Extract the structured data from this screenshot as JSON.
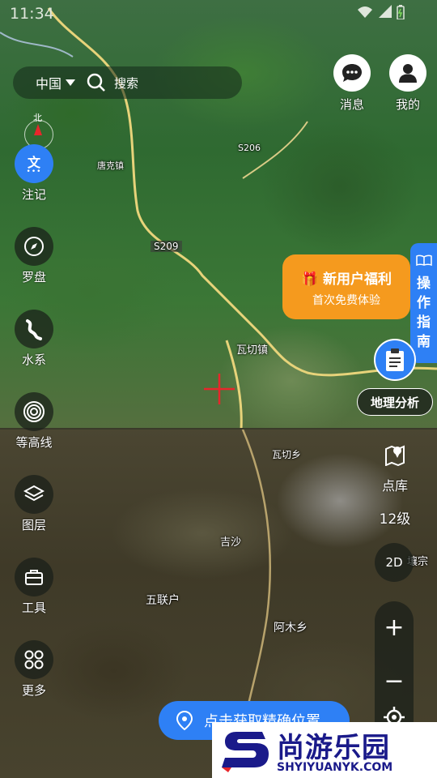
{
  "status_bar": {
    "time": "11:34"
  },
  "search": {
    "region": "中国",
    "placeholder": "搜索"
  },
  "top_actions": [
    {
      "label": "消息",
      "icon": "message-icon"
    },
    {
      "label": "我的",
      "icon": "user-icon"
    }
  ],
  "left_tools": [
    {
      "label": "注记",
      "icon": "annotation-icon",
      "active": true,
      "glyph": "文"
    },
    {
      "label": "罗盘",
      "icon": "compass-icon"
    },
    {
      "label": "水系",
      "icon": "river-icon"
    },
    {
      "label": "等高线",
      "icon": "contour-icon"
    },
    {
      "label": "图层",
      "icon": "layers-icon"
    },
    {
      "label": "工具",
      "icon": "toolbox-icon"
    },
    {
      "label": "更多",
      "icon": "more-icon"
    }
  ],
  "promo": {
    "title": "新用户福利",
    "subtitle": "首次免费体验"
  },
  "guide": {
    "label": "操作指南"
  },
  "analysis": {
    "label": "地理分析"
  },
  "right_tools": {
    "poi_label": "点库",
    "zoom_level": "12级",
    "view_mode": "2D",
    "zoom_in": "+",
    "zoom_out": "−"
  },
  "locate": {
    "label": "点击获取精确位置"
  },
  "map_labels": {
    "road_s209": "S209",
    "road_s206": "S206",
    "town_top": "瓦切镇",
    "town_bottom": "瓦切乡",
    "jisha": "吉沙",
    "wulianhu": "五联户",
    "amuxiang": "阿木乡",
    "tangke": "唐克镇",
    "rangzong": "壤宗",
    "north": "北"
  },
  "watermark": {
    "main": "尚游乐园",
    "sub": "SHYIYUANYK.COM"
  },
  "colors": {
    "accent": "#2e80f5",
    "promo": "#f59a1e",
    "crosshair": "#e8262b"
  }
}
